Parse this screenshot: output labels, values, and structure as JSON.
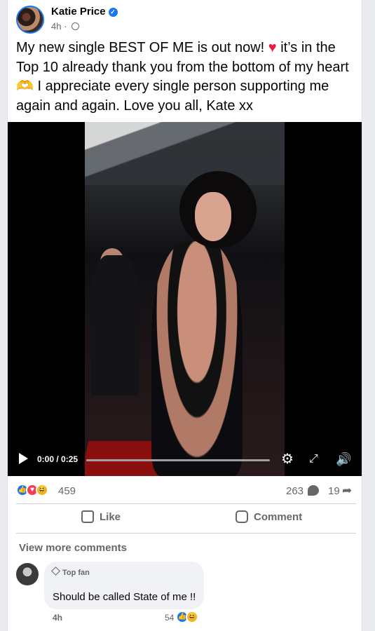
{
  "post": {
    "author": "Katie Price",
    "time": "4h ·",
    "text_part1": "My new single BEST OF ME is out now! ",
    "heart_emoji": "♥",
    "text_part2": " it’s in the Top 10 already thank you from the bottom of my heart ",
    "hands_emoji": "🫶",
    "text_part3": " I appreciate every single person supporting me again and again. Love you all, Kate xx"
  },
  "video": {
    "time": "0:00 / 0:25",
    "progress": 0.0,
    "settings_icon": "settings-icon",
    "fullscreen_icon": "fullscreen-icon",
    "volume_icon": "volume-icon"
  },
  "reactions": {
    "count": "459",
    "comments": "263",
    "shares": "19",
    "types": [
      "like",
      "love",
      "haha"
    ]
  },
  "actions": {
    "like": "Like",
    "comment": "Comment"
  },
  "comments_section": {
    "view_more": "View more comments",
    "comment": {
      "badge": "Top fan",
      "text": "Should be called State of me !!",
      "time": "4h",
      "reaction_count": "54"
    }
  },
  "colors": {
    "brand": "#1877f2",
    "love": "#f33e58",
    "haha": "#f7b125",
    "muted": "#65676b"
  }
}
